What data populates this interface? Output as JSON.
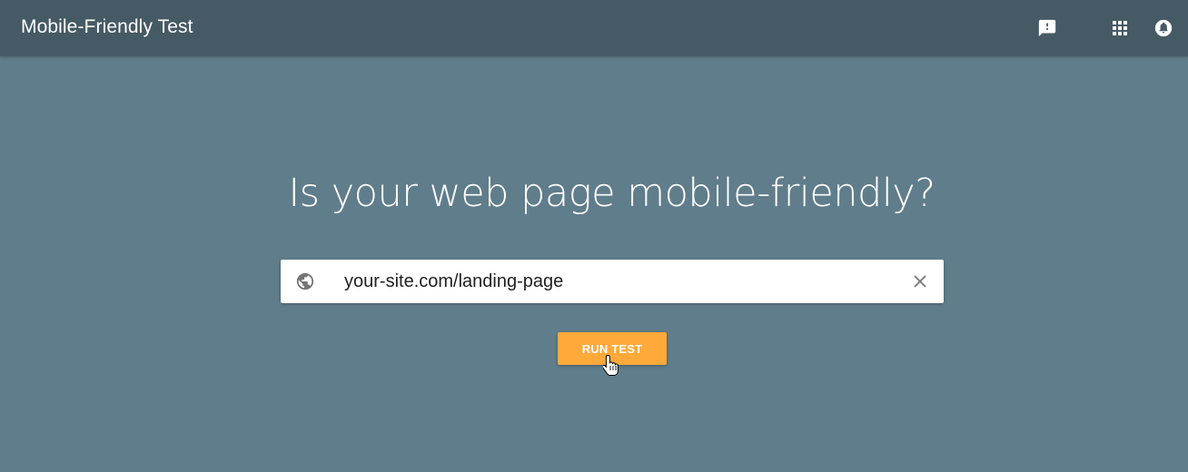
{
  "header": {
    "title": "Mobile-Friendly Test",
    "icons": [
      "feedback-icon",
      "apps-grid-icon",
      "notifications-icon"
    ]
  },
  "main": {
    "headline": "Is your web page mobile-friendly?",
    "url_input": {
      "value": "your-site.com/landing-page",
      "icon": "globe-icon",
      "clear_icon": "close-icon"
    },
    "run_button_label": "RUN TEST"
  },
  "colors": {
    "header_bg": "#455a64",
    "page_bg": "#607d8b",
    "button_bg": "#ffa93a",
    "text_light": "#ffffff"
  }
}
